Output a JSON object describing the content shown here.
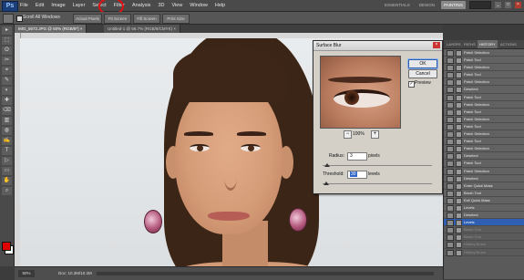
{
  "app": {
    "logo": "Ps"
  },
  "menu": [
    "File",
    "Edit",
    "Image",
    "Layer",
    "Select",
    "Filter",
    "Analysis",
    "3D",
    "View",
    "Window",
    "Help"
  ],
  "workspaces": [
    "ESSENTIALS",
    "DESIGN",
    "PAINTING"
  ],
  "window_controls": {
    "minimize": "_",
    "maximize": "□",
    "close": "×"
  },
  "options_bar": {
    "scroll_all_windows": "Scroll All Windows",
    "buttons": [
      "Actual Pixels",
      "Fit Screen",
      "Fill Screen",
      "Print Size"
    ]
  },
  "document": {
    "tabs": [
      "IMG_5672.JPG @ 50% (RGB/8*) ×",
      "Untitled-1 @ 66.7% (RGB/8/CMYK) ×"
    ],
    "zoom": "50%",
    "info": "Doc: 10.3M/10.2M"
  },
  "dialog": {
    "title": "Surface Blur",
    "close": "×",
    "ok": "OK",
    "cancel": "Cancel",
    "preview_label": "Preview",
    "preview_checked": "✓",
    "zoom_out": "−",
    "zoom_in": "+",
    "zoom_level": "100%",
    "radius_label": "Radius:",
    "radius_value": "3",
    "radius_unit": "pixels",
    "threshold_label": "Threshold:",
    "threshold_value": "30",
    "threshold_unit": "levels"
  },
  "panel": {
    "tabs": [
      "LAYERS",
      "PATHS",
      "HISTORY",
      "ACTIONS"
    ],
    "history": [
      {
        "label": "Patch Selection",
        "state": "normal"
      },
      {
        "label": "Patch Tool",
        "state": "normal"
      },
      {
        "label": "Patch Selection",
        "state": "normal"
      },
      {
        "label": "Patch Tool",
        "state": "normal"
      },
      {
        "label": "Patch Selection",
        "state": "normal"
      },
      {
        "label": "Deselect",
        "state": "normal"
      },
      {
        "label": "Patch Tool",
        "state": "normal"
      },
      {
        "label": "Patch Selection",
        "state": "normal"
      },
      {
        "label": "Patch Tool",
        "state": "normal"
      },
      {
        "label": "Patch Selection",
        "state": "normal"
      },
      {
        "label": "Patch Tool",
        "state": "normal"
      },
      {
        "label": "Patch Selection",
        "state": "normal"
      },
      {
        "label": "Patch Tool",
        "state": "normal"
      },
      {
        "label": "Patch Selection",
        "state": "normal"
      },
      {
        "label": "Deselect",
        "state": "normal"
      },
      {
        "label": "Patch Tool",
        "state": "normal"
      },
      {
        "label": "Patch Selection",
        "state": "normal"
      },
      {
        "label": "Deselect",
        "state": "normal"
      },
      {
        "label": "Enter Quick Mask",
        "state": "normal"
      },
      {
        "label": "Brush Tool",
        "state": "normal"
      },
      {
        "label": "Exit Quick Mask",
        "state": "normal"
      },
      {
        "label": "Levels",
        "state": "normal"
      },
      {
        "label": "Deselect",
        "state": "normal"
      },
      {
        "label": "Levels",
        "state": "active"
      },
      {
        "label": "Brush Tool",
        "state": "dim"
      },
      {
        "label": "Brush Tool",
        "state": "dim"
      },
      {
        "label": "History Brush",
        "state": "dim"
      },
      {
        "label": "History Brush",
        "state": "dim"
      }
    ]
  },
  "tools": [
    "▸",
    "⬚",
    "ʘ",
    "✂",
    "⌖",
    "✎",
    "◐",
    "✚",
    "⌫",
    "▥",
    "◍",
    "✍",
    "T",
    "▷",
    "▭",
    "✋",
    "⌕"
  ],
  "colors": {
    "foreground": "#e00000",
    "background": "#ffffff",
    "highlight_circle": "#e01010",
    "active_history": "#2f5fb3"
  }
}
